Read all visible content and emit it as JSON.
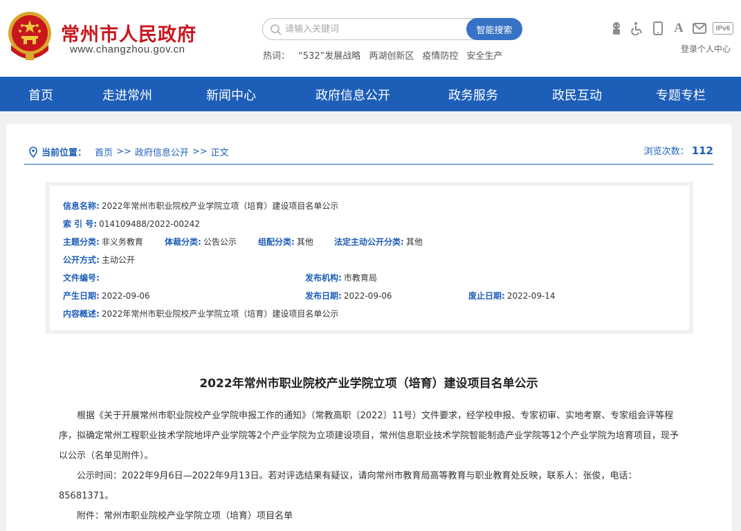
{
  "header": {
    "site_name": "常州市人民政府",
    "site_url": "www.changzhou.gov.cn",
    "search_placeholder": "请输入关键词",
    "search_button": "智能搜索",
    "hot_label": "热词：",
    "hot_words": [
      "“532”发展战略",
      "两湖创新区",
      "疫情防控",
      "安全生产"
    ],
    "tool_icons": [
      "elder-care-icon",
      "accessibility-icon",
      "mobile-icon",
      "font-size-icon",
      "mail-icon",
      "ipv6-badge"
    ],
    "ipv6_label": "IPv6",
    "font_label": "A",
    "login": "登录个人中心",
    "colors": {
      "brand_red": "#c8161d",
      "nav_blue": "#1d5eb8",
      "button_blue": "#3672c5"
    }
  },
  "nav": [
    "首页",
    "走进常州",
    "新闻中心",
    "政府信息公开",
    "政务服务",
    "政民互动",
    "专题专栏"
  ],
  "breadcrumb": {
    "label": "当前位置：",
    "items": [
      "首页",
      "政府信息公开",
      "正文"
    ],
    "separator": ">>",
    "views_label": "浏览次数：",
    "views": "112"
  },
  "meta": {
    "name_label": "信息名称:",
    "name": "2022年常州市职业院校产业学院立项（培育）建设项目名单公示",
    "index_label": "索 引 号:",
    "index": "014109488/2022-00242",
    "topic_label": "主题分类:",
    "topic": "非义务教育",
    "genre_label": "体裁分类:",
    "genre": "公告公示",
    "org_class_label": "组配分类:",
    "org_class": "其他",
    "legal_class_label": "法定主动公开分类:",
    "legal_class": "其他",
    "mode_label": "公开方式:",
    "mode": "主动公开",
    "doc_no_label": "文件编号:",
    "doc_no": "",
    "publisher_label": "发布机构:",
    "publisher": "市教育局",
    "created_label": "产生日期:",
    "created": "2022-09-06",
    "published_label": "发布日期:",
    "published": "2022-09-06",
    "expire_label": "废止日期:",
    "expire": "2022-09-14",
    "summary_label": "内容概述:",
    "summary": "2022年常州市职业院校产业学院立项（培育）建设项目名单公示"
  },
  "article": {
    "title": "2022年常州市职业院校产业学院立项（培育）建设项目名单公示",
    "p1": "根据《关于开展常州市职业院校产业学院申报工作的通知》（常教高职〔2022〕11号）文件要求，经学校申报、专家初审、实地考察、专家组会评等程序，拟确定常州工程职业技术学院地坪产业学院等2个产业学院为立项建设项目，常州信息职业技术学院智能制造产业学院等12个产业学院为培育项目，现予以公示（名单见附件）。",
    "p2": "公示时间：2022年9月6日—2022年9月13日。若对评选结果有疑议，请向常州市教育局高等教育与职业教育处反映，联系人：张俊，电话：85681371。",
    "p3": "附件：常州市职业院校产业学院立项（培育）项目名单"
  }
}
